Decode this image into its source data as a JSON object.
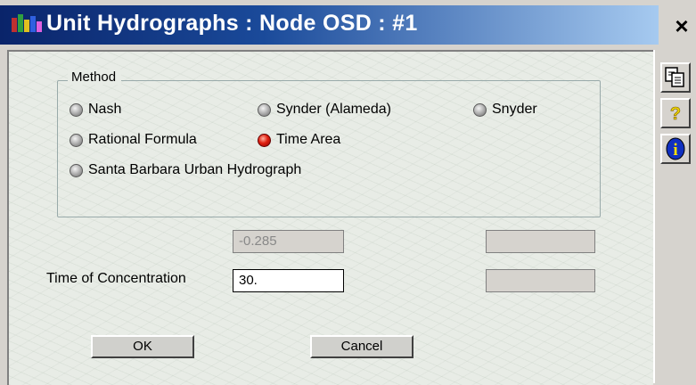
{
  "window": {
    "title": "Unit Hydrographs : Node OSD : #1",
    "close_label": "×"
  },
  "method": {
    "legend": "Method",
    "options": [
      {
        "label": "Nash",
        "selected": false
      },
      {
        "label": "Synder (Alameda)",
        "selected": false
      },
      {
        "label": "Snyder",
        "selected": false
      },
      {
        "label": "Rational Formula",
        "selected": false
      },
      {
        "label": "Time Area",
        "selected": true
      },
      {
        "label": "Santa Barbara Urban Hydrograph",
        "selected": false
      }
    ]
  },
  "fields": {
    "disabled_value": "-0.285",
    "time_of_concentration_label": "Time of Concentration",
    "time_of_concentration_value": "30.",
    "right_top_value": "",
    "right_bottom_value": ""
  },
  "buttons": {
    "ok": "OK",
    "cancel": "Cancel"
  },
  "sidebar": {
    "icons": [
      "copy-icon",
      "help-icon",
      "info-icon"
    ],
    "help_glyph": "?",
    "info_glyph": "i"
  },
  "colors": {
    "title_start": "#0a246a",
    "title_end": "#a6caf0",
    "client_bg": "#e8ece6",
    "radio_selected": "#e02010",
    "info_blue": "#1030c0"
  }
}
